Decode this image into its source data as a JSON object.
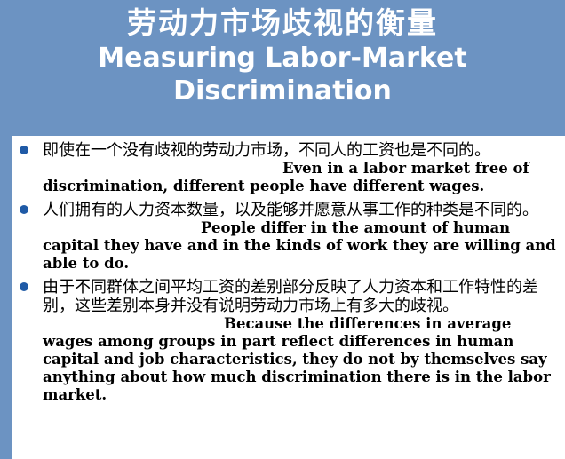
{
  "title": {
    "zh": "劳动力市场歧视的衡量",
    "en_line1": "Measuring Labor-Market",
    "en_line2": "Discrimination"
  },
  "bullets": [
    {
      "zh": "即使在一个没有歧视的劳动力市场，不同人的工资也是不同的。",
      "en": "Even in a labor market free of discrimination, different people have different wages."
    },
    {
      "zh": "人们拥有的人力资本数量，以及能够并愿意从事工作的种类是不同的。",
      "en": "People differ in the amount of human capital they have and in the kinds of work they are willing and able to do."
    },
    {
      "zh": "由于不同群体之间平均工资的差别部分反映了人力资本和工作特性的差别，这些差别本身并没有说明劳动力市场上有多大的歧视。",
      "en": "Because the differences in average wages among groups in part reflect differences in human capital and job characteristics, they do not by themselves say anything about how much discrimination there is in the labor market."
    }
  ],
  "colors": {
    "background": "#6c93c2",
    "panel": "#ffffff",
    "bullet": "#1f5aa6",
    "title_text": "#ffffff"
  }
}
